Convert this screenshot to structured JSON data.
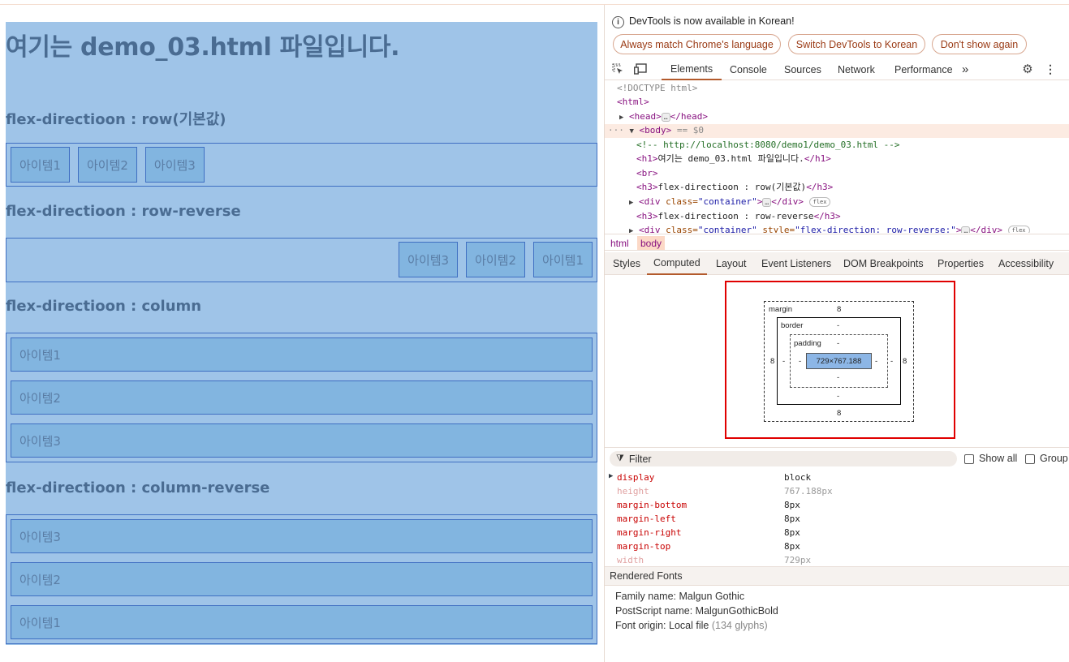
{
  "page": {
    "h1": "여기는 demo_03.html 파일입니다.",
    "sections": [
      {
        "heading": "flex-directioon : row(기본값)",
        "items": [
          "아이템1",
          "아이템2",
          "아이템3"
        ]
      },
      {
        "heading": "flex-directioon : row-reverse",
        "items": [
          "아이템3",
          "아이템2",
          "아이템1"
        ]
      },
      {
        "heading": "flex-directioon : column",
        "items": [
          "아이템1",
          "아이템2",
          "아이템3"
        ]
      },
      {
        "heading": "flex-directioon : column-reverse",
        "items": [
          "아이템3",
          "아이템2",
          "아이템1"
        ]
      }
    ]
  },
  "devtools": {
    "info_icon": "info-icon",
    "info_text": "DevTools is now available in Korean!",
    "buttons": [
      "Always match Chrome's language",
      "Switch DevTools to Korean",
      "Don't show again"
    ],
    "tabs": [
      "Elements",
      "Console",
      "Sources",
      "Network",
      "Performance"
    ],
    "more_tabs": "»",
    "dom": {
      "doctype": "<!DOCTYPE html>",
      "html": "<html>",
      "head_open": "<head>",
      "head_close": "</head>",
      "body": "<body>",
      "body_suffix": "== $0",
      "comment": "<!--  http://localhost:8080/demo1/demo_03.html  -->",
      "h1_open": "<h1>",
      "h1_text": "여기는 demo_03.html 파일입니다.",
      "h1_close": "</h1>",
      "br": "<br>",
      "h3_open": "<h3>",
      "h3_1_text": "flex-directioon : row(기본값)",
      "h3_close": "</h3>",
      "div_open": "<div ",
      "attr_class": "class=",
      "val_container": "\"container\"",
      "gt": ">",
      "div_close": "</div>",
      "h3_2_text": "flex-directioon : row-reverse",
      "attr_style": " style=",
      "val_style": "\"flex-direction: row-reverse;\"",
      "flex_badge": "flex",
      "ellipsis": "…"
    },
    "crumbs": [
      "html",
      "body"
    ],
    "subtabs": [
      "Styles",
      "Computed",
      "Layout",
      "Event Listeners",
      "DOM Breakpoints",
      "Properties",
      "Accessibility"
    ],
    "box_model": {
      "margin_label": "margin",
      "border_label": "border",
      "padding_label": "padding",
      "margin_top": "8",
      "margin_bottom": "8",
      "margin_left": "8",
      "margin_right": "8",
      "border_top": "-",
      "border_bottom": "-",
      "border_left": "-",
      "border_right": "-",
      "padding_top": "-",
      "padding_bottom": "-",
      "padding_left": "-",
      "padding_right": "-",
      "content": "729×767.188"
    },
    "filter_placeholder": "Filter",
    "show_all": "Show all",
    "group": "Group",
    "properties": [
      {
        "name": "display",
        "value": "block"
      },
      {
        "name": "height",
        "value": "767.188px"
      },
      {
        "name": "margin-bottom",
        "value": "8px"
      },
      {
        "name": "margin-left",
        "value": "8px"
      },
      {
        "name": "margin-right",
        "value": "8px"
      },
      {
        "name": "margin-top",
        "value": "8px"
      },
      {
        "name": "width",
        "value": "729px"
      }
    ],
    "rendered_fonts": {
      "title": "Rendered Fonts",
      "family": "Family name: Malgun Gothic",
      "postscript": "PostScript name: MalgunGothicBold",
      "origin_prefix": "Font origin: Local file",
      "origin_glyphs": "(134 glyphs)"
    }
  }
}
